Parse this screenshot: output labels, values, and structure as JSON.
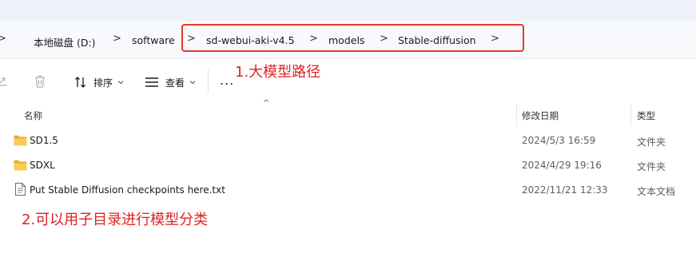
{
  "breadcrumb": {
    "items": [
      "本地磁盘 (D:)",
      "software",
      "sd-webui-aki-v4.5",
      "models",
      "Stable-diffusion"
    ],
    "separator": ">"
  },
  "toolbar": {
    "sort_label": "排序",
    "view_label": "查看",
    "more_label": "..."
  },
  "annotations": {
    "model_path": "1.大模型路径",
    "subdir_tip": "2.可以用子目录进行模型分类"
  },
  "columns": {
    "name": "名称",
    "date": "修改日期",
    "type": "类型"
  },
  "files": [
    {
      "name": "SD1.5",
      "date": "2024/5/3 16:59",
      "type": "文件夹",
      "icon": "folder-icon"
    },
    {
      "name": "SDXL",
      "date": "2024/4/29 19:16",
      "type": "文件夹",
      "icon": "folder-icon"
    },
    {
      "name": "Put Stable Diffusion checkpoints here.txt",
      "date": "2022/11/21 12:33",
      "type": "文本文档",
      "icon": "text-file-icon"
    }
  ],
  "colors": {
    "annotation": "#e02020",
    "highlight_box": "#e53935",
    "folder": "#f5c342"
  }
}
